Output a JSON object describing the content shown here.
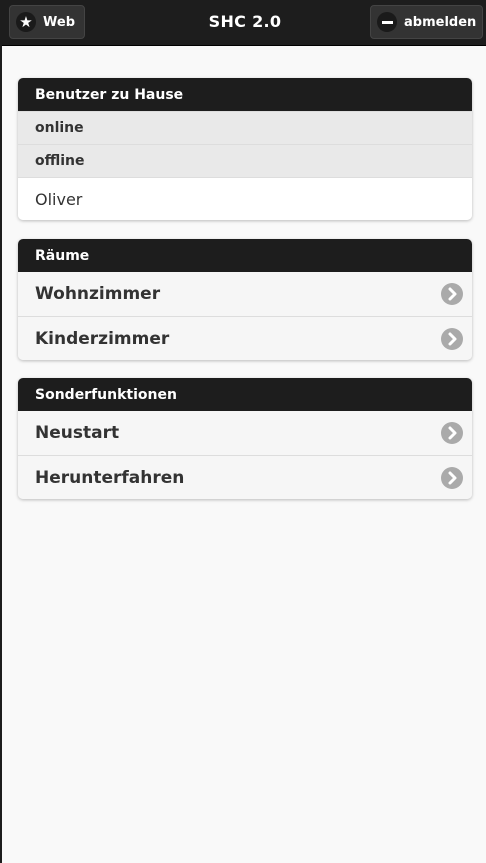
{
  "header": {
    "left_button": "Web",
    "title": "SHC 2.0",
    "right_button": "abmelden"
  },
  "users": {
    "title": "Benutzer zu Hause",
    "online_label": "online",
    "offline_label": "offline",
    "offline_users": [
      "Oliver"
    ]
  },
  "rooms": {
    "title": "Räume",
    "items": [
      {
        "label": "Wohnzimmer"
      },
      {
        "label": "Kinderzimmer"
      }
    ]
  },
  "special": {
    "title": "Sonderfunktionen",
    "items": [
      {
        "label": "Neustart"
      },
      {
        "label": "Herunterfahren"
      }
    ]
  },
  "icons": {
    "left_button": "star-icon",
    "right_button": "minus-icon",
    "row_arrow": "chevron-right-icon"
  }
}
